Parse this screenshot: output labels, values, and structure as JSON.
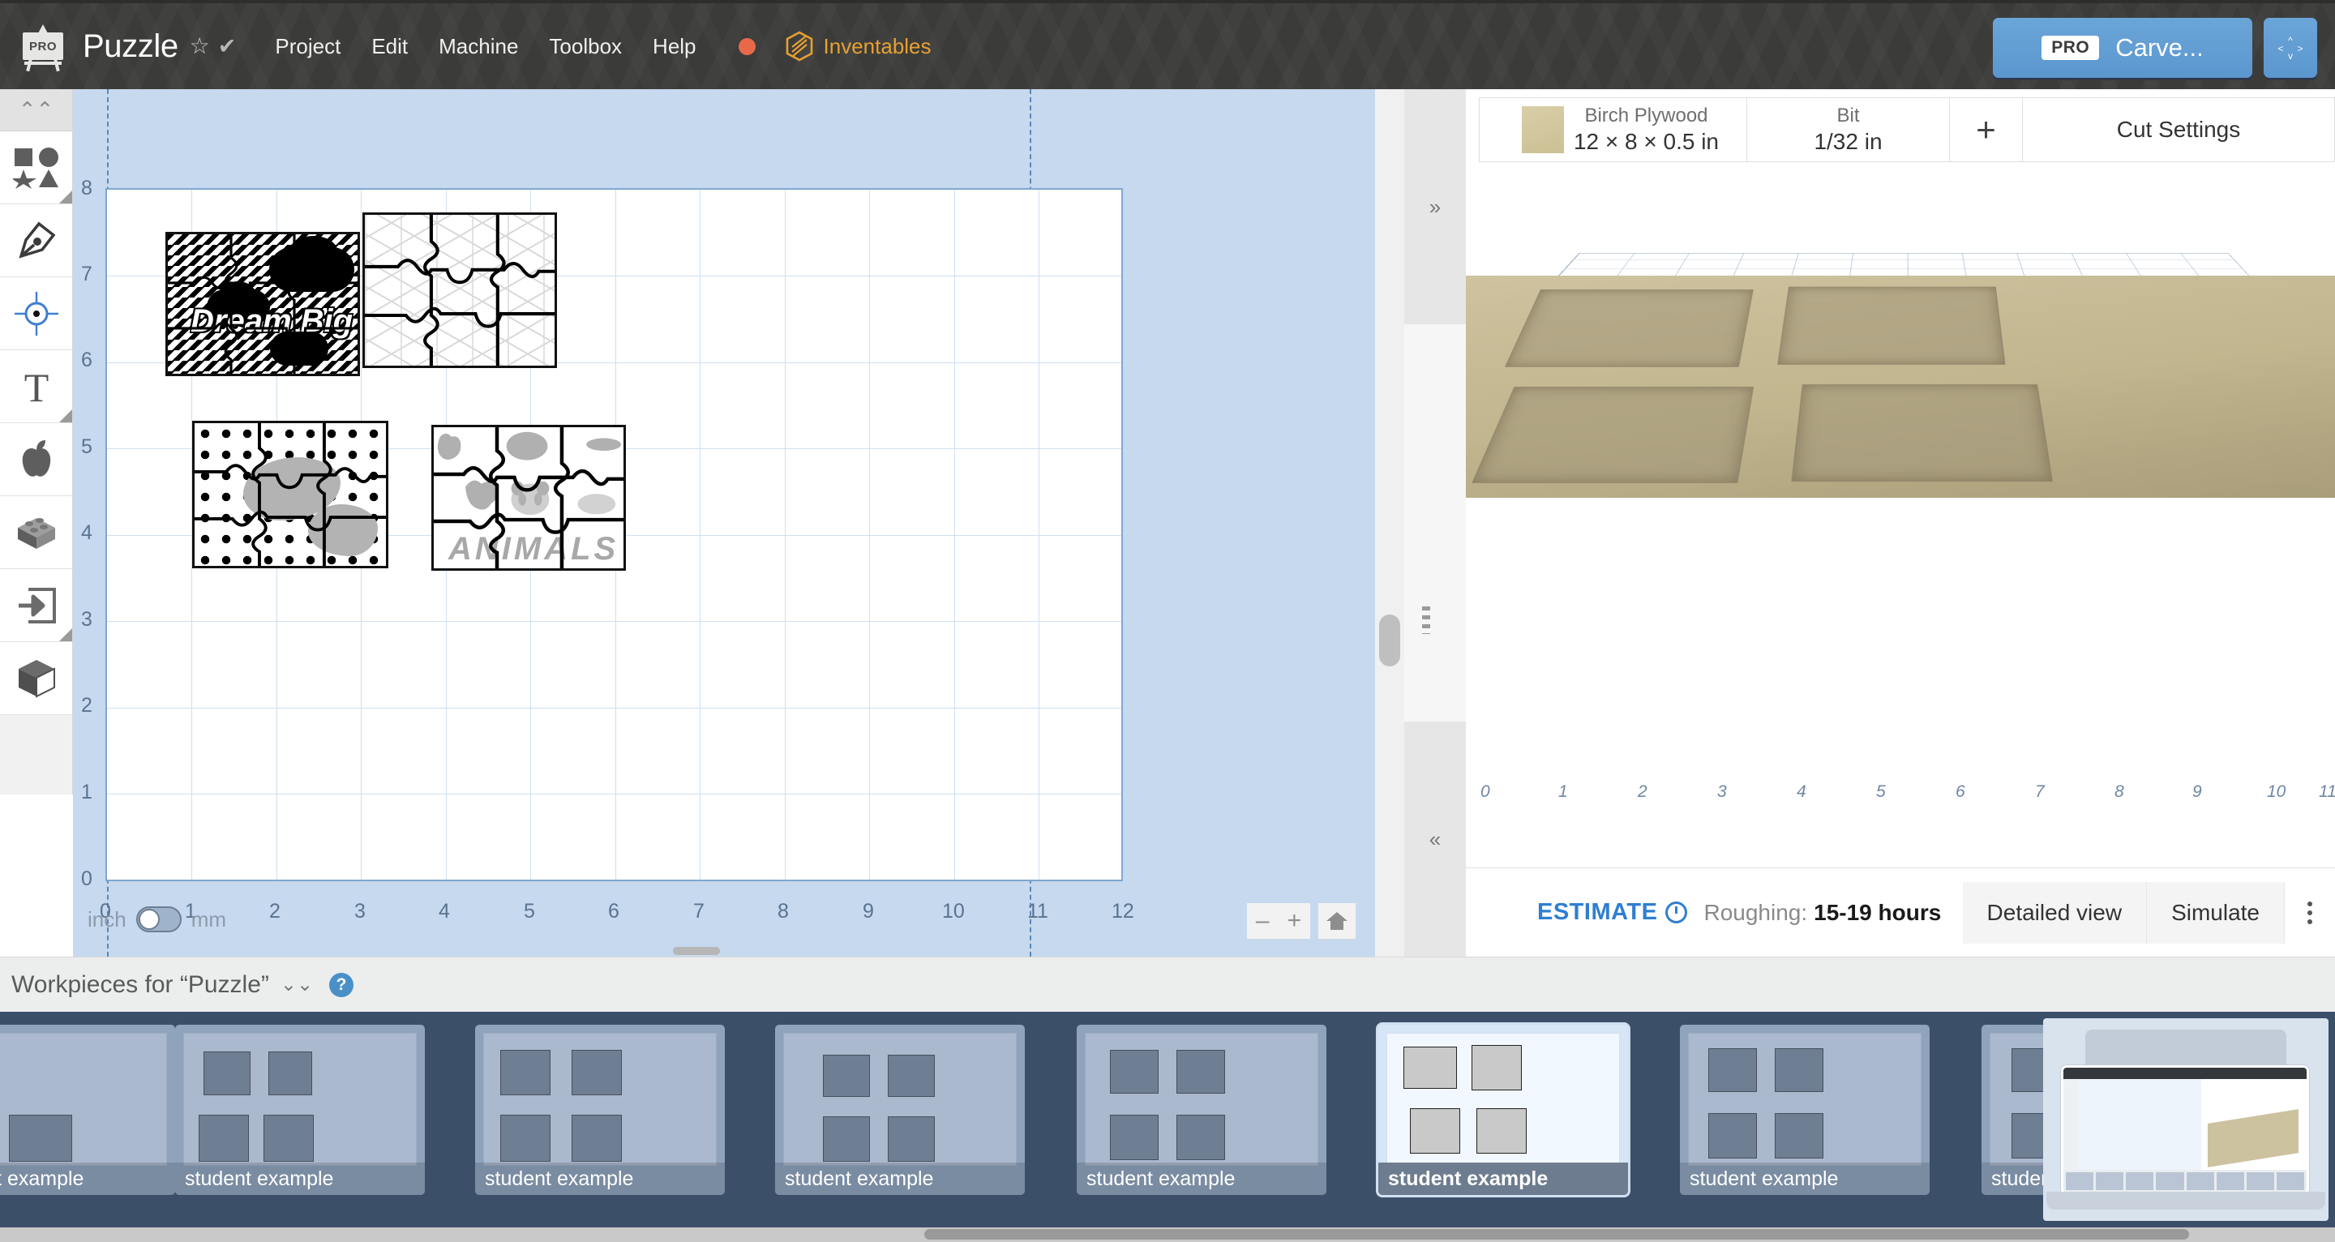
{
  "app": {
    "logo_badge": "PRO",
    "project_title": "Puzzle",
    "star_icon": "star-outline-icon",
    "check_icon": "check-icon",
    "menu": [
      "Project",
      "Edit",
      "Machine",
      "Toolbox",
      "Help"
    ],
    "status_dot_color": "#e8694a",
    "inventables_label": "Inventables",
    "carve_badge": "PRO",
    "carve_label": "Carve...",
    "expand_icon": "expand-arrows-icon"
  },
  "left_toolbar": {
    "collapse_icon": "chevron-double-up-icon",
    "tools": [
      {
        "name": "shapes-tool",
        "icon": "shapes-icon",
        "has_corner": true
      },
      {
        "name": "pen-tool",
        "icon": "pen-nib-icon",
        "has_corner": false
      },
      {
        "name": "center-point-tool",
        "icon": "crosshair-target-icon",
        "has_corner": false
      },
      {
        "name": "text-tool",
        "icon": "text-t-icon",
        "has_corner": true
      },
      {
        "name": "apps-tool",
        "icon": "apple-icon",
        "has_corner": false
      },
      {
        "name": "brick-tool",
        "icon": "lego-brick-icon",
        "has_corner": false
      },
      {
        "name": "import-tool",
        "icon": "import-arrow-icon",
        "has_corner": true
      },
      {
        "name": "three-d-tool",
        "icon": "cube-icon",
        "has_corner": false
      }
    ]
  },
  "canvas": {
    "y_axis_labels": [
      "8",
      "7",
      "6",
      "5",
      "4",
      "3",
      "2",
      "1",
      "0"
    ],
    "x_axis_labels": [
      "0",
      "1",
      "2",
      "3",
      "4",
      "5",
      "6",
      "7",
      "8",
      "9",
      "10",
      "11",
      "12"
    ],
    "unit_left": "inch",
    "unit_right": "mm",
    "unit_selected": "inch",
    "zoom_out_icon": "minus-icon",
    "zoom_in_icon": "plus-icon",
    "home_icon": "home-icon",
    "boards": [
      {
        "name": "dream-big-board",
        "pattern": "chevron",
        "caption": "Dream Big"
      },
      {
        "name": "geometric-board",
        "pattern": "geometric",
        "caption": ""
      },
      {
        "name": "polka-dot-board",
        "pattern": "dots",
        "caption": ""
      },
      {
        "name": "animals-board",
        "pattern": "plain",
        "caption": "ANIMALS"
      }
    ]
  },
  "divider": {
    "expand_right_icon": "chevron-double-right-icon",
    "collapse_left_icon": "chevron-double-left-icon",
    "drag_handle_icon": "drag-handle-icon"
  },
  "preview": {
    "material_name": "Birch Plywood",
    "material_size": "12 × 8 × 0.5 in",
    "bit_label": "Bit",
    "bit_value": "1/32 in",
    "add_icon": "plus-icon",
    "cut_settings_label": "Cut Settings",
    "ruler_labels": [
      "0",
      "1",
      "2",
      "3",
      "4",
      "5",
      "6",
      "7",
      "8",
      "9",
      "10",
      "11"
    ],
    "estimate_word": "ESTIMATE",
    "estimate_info_icon": "info-clock-icon",
    "estimate_prefix": "Roughing:",
    "estimate_value": "15-19 hours",
    "detailed_view_label": "Detailed view",
    "simulate_label": "Simulate",
    "more_icon": "kebab-menu-icon"
  },
  "workpieces": {
    "header": "Workpieces for “Puzzle”",
    "chevron_icon": "chevron-double-down-icon",
    "help_icon": "help-circle-icon",
    "items": [
      {
        "label": "student example",
        "selected": false
      },
      {
        "label": "student example",
        "selected": false
      },
      {
        "label": "student example",
        "selected": false
      },
      {
        "label": "student example",
        "selected": false
      },
      {
        "label": "student example",
        "selected": false
      },
      {
        "label": "student example",
        "selected": true
      },
      {
        "label": "student example",
        "selected": false
      },
      {
        "label": "student example",
        "selected": false
      }
    ]
  }
}
